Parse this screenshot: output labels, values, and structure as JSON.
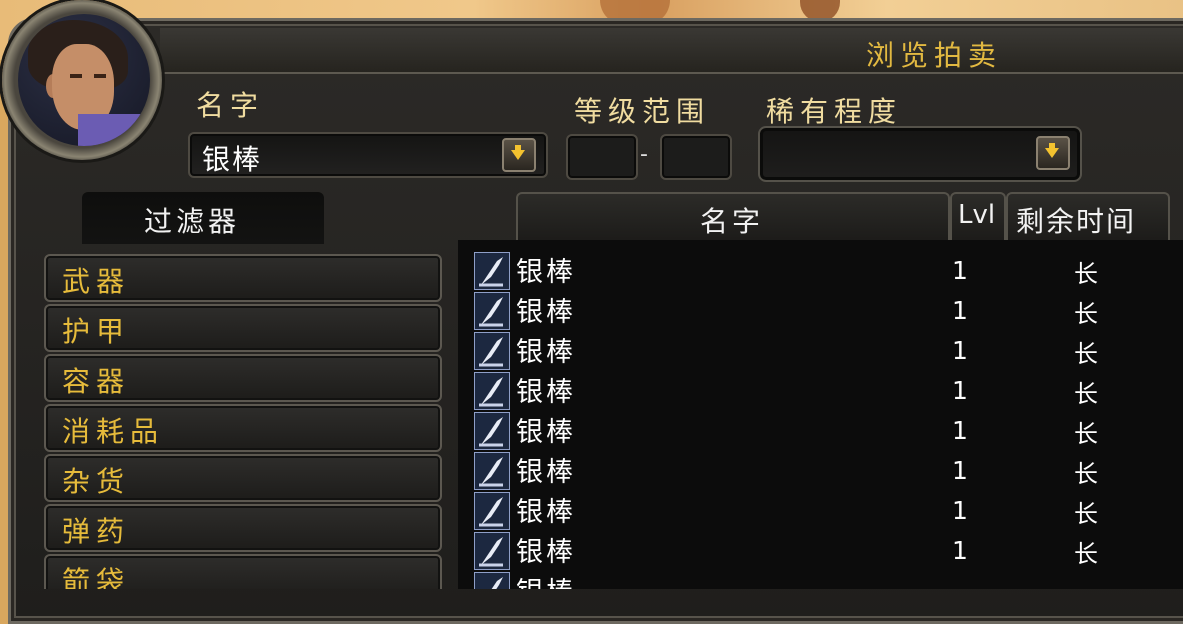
{
  "window": {
    "title": "浏览拍卖"
  },
  "search": {
    "name_label": "名字",
    "name_value": "银棒",
    "level_range_label": "等级范围",
    "level_min": "",
    "level_max": "",
    "level_separator": "-",
    "rarity_label": "稀有程度",
    "rarity_value": ""
  },
  "filters": {
    "tab_label": "过滤器",
    "categories": [
      "武器",
      "护甲",
      "容器",
      "消耗品",
      "杂货",
      "弹药",
      "箭袋"
    ]
  },
  "results": {
    "columns": {
      "name": "名字",
      "level": "Lvl",
      "time_left": "剩余时间"
    },
    "rows": [
      {
        "name": "银棒",
        "level": "1",
        "time_left": "长"
      },
      {
        "name": "银棒",
        "level": "1",
        "time_left": "长"
      },
      {
        "name": "银棒",
        "level": "1",
        "time_left": "长"
      },
      {
        "name": "银棒",
        "level": "1",
        "time_left": "长"
      },
      {
        "name": "银棒",
        "level": "1",
        "time_left": "长"
      },
      {
        "name": "银棒",
        "level": "1",
        "time_left": "长"
      },
      {
        "name": "银棒",
        "level": "1",
        "time_left": "长"
      },
      {
        "name": "银棒",
        "level": "1",
        "time_left": "长"
      },
      {
        "name": "银棒",
        "level": "",
        "time_left": ""
      }
    ]
  },
  "colors": {
    "gold_text": "#e6bb3b",
    "title_gold": "#e2b941",
    "label_cream": "#f0dca0",
    "panel_dark": "#1b1a18",
    "item_icon_blue": "#8f9fc8"
  },
  "icons": {
    "portrait": "player-portrait",
    "dropdown": "dropdown-arrow-icon",
    "item": "silver-rod-icon"
  }
}
